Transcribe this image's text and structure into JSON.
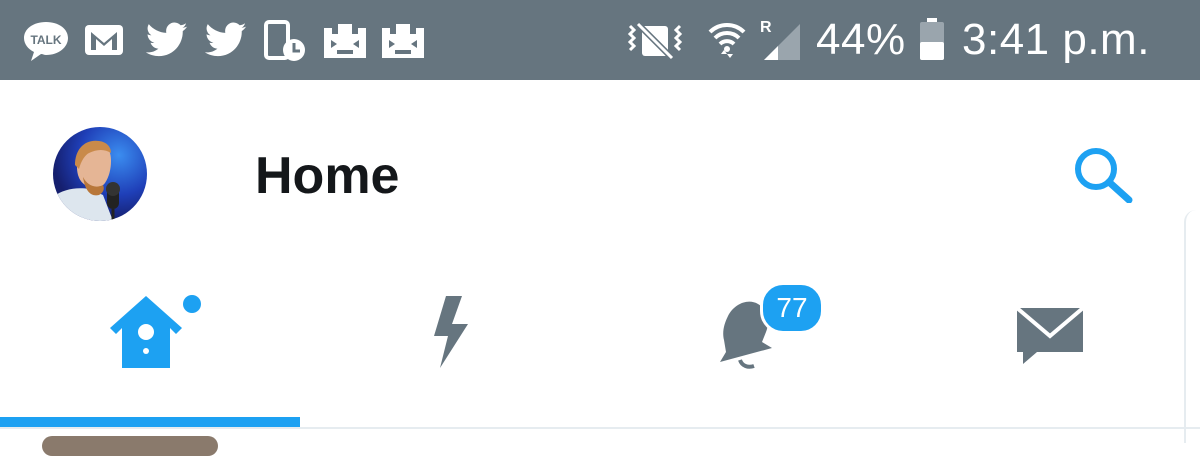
{
  "status_bar": {
    "battery": "44%",
    "time": "3:41 p.m.",
    "roaming_indicator": "R",
    "notification_icons": [
      "talk-icon",
      "gmail-icon",
      "twitter-icon",
      "twitter-icon",
      "phone-clock-icon",
      "castle-game-icon",
      "castle-game-icon"
    ],
    "talk_icon_text": "TALK"
  },
  "header": {
    "title": "Home"
  },
  "tabs": [
    {
      "name": "home",
      "icon": "birdhouse-icon",
      "active": true,
      "has_dot": true
    },
    {
      "name": "moments",
      "icon": "lightning-icon",
      "active": false
    },
    {
      "name": "notifications",
      "icon": "bell-icon",
      "active": false,
      "badge": "77"
    },
    {
      "name": "messages",
      "icon": "envelope-icon",
      "active": false
    }
  ],
  "colors": {
    "status_bar_bg": "#66757f",
    "accent": "#1da1f2",
    "icon_inactive": "#66757f",
    "title": "#14171a"
  }
}
